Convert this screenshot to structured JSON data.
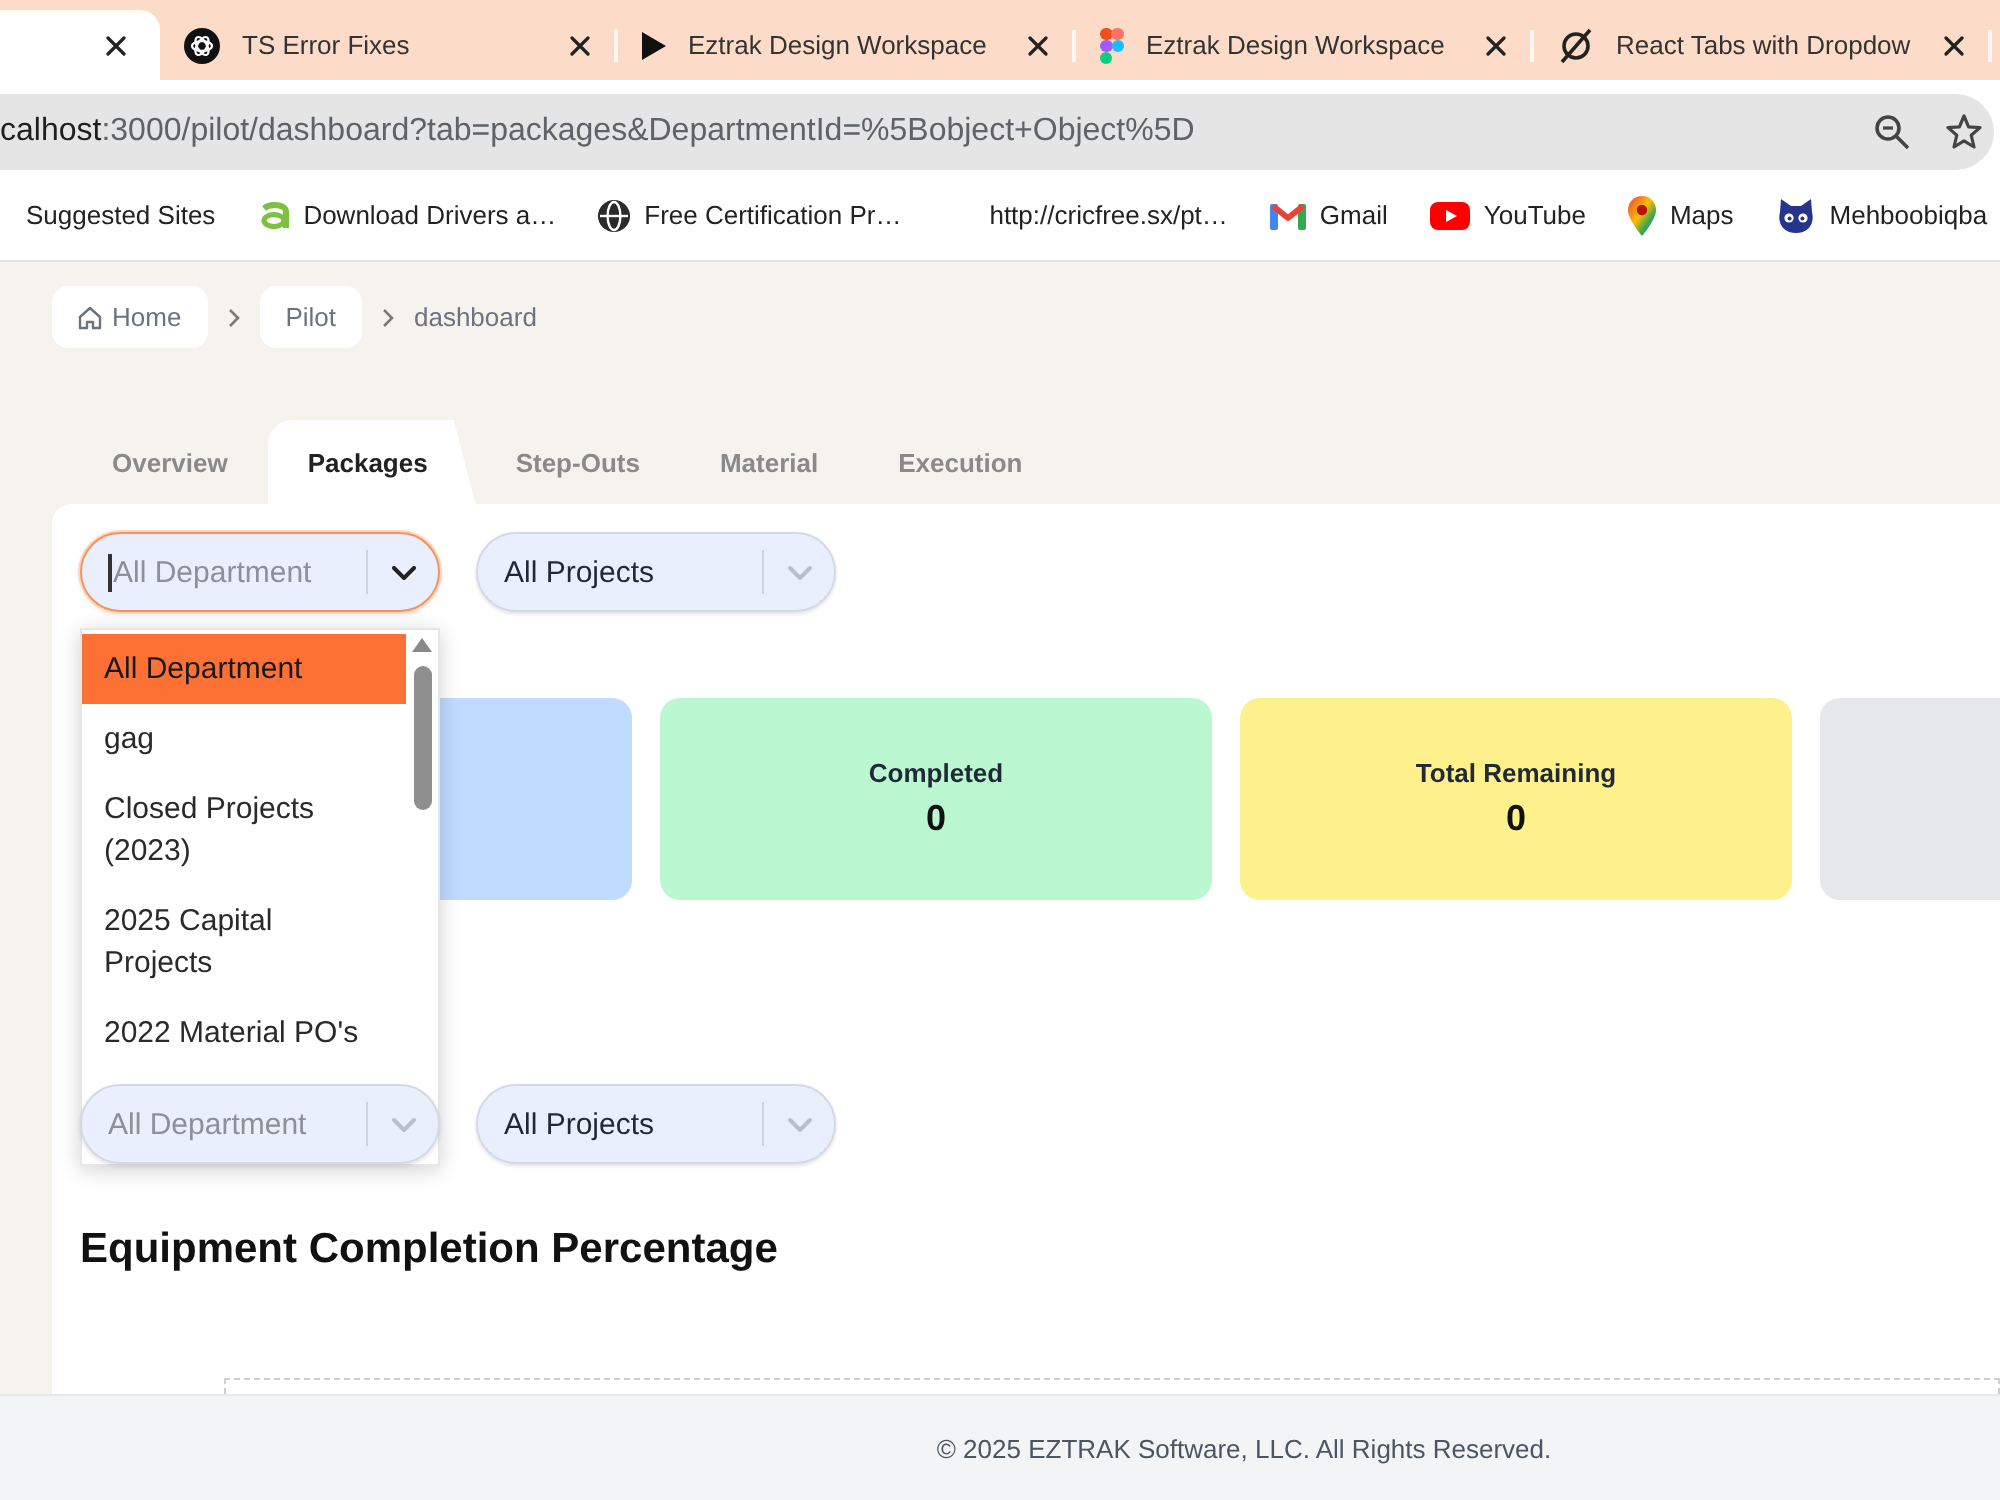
{
  "browser": {
    "tabs": [
      {
        "selected": true
      },
      {
        "title": "TS Error Fixes",
        "selected": false
      },
      {
        "title": "Eztrak Design Workspace",
        "selected": false
      },
      {
        "title": "Eztrak Design Workspace",
        "selected": false
      },
      {
        "title": "React Tabs with Dropdow",
        "selected": false
      }
    ],
    "address": {
      "host": "calhost",
      "path": ":3000/pilot/dashboard?tab=packages&DepartmentId=%5Bobject+Object%5D"
    },
    "bookmarks": [
      "Suggested Sites",
      "Download Drivers a…",
      "Free Certification Pr…",
      "http://cricfree.sx/pt…",
      "Gmail",
      "YouTube",
      "Maps",
      "Mehboobiqba"
    ]
  },
  "breadcrumb": [
    {
      "label": "Home",
      "kind": "link"
    },
    {
      "label": "Pilot",
      "kind": "link"
    },
    {
      "label": "dashboard",
      "kind": "current"
    }
  ],
  "tabs": [
    {
      "label": "Overview",
      "selected": false
    },
    {
      "label": "Packages",
      "selected": true
    },
    {
      "label": "Step-Outs",
      "selected": false
    },
    {
      "label": "Material",
      "selected": false
    },
    {
      "label": "Execution",
      "selected": false
    }
  ],
  "filters": [
    {
      "placeholder": "All Department",
      "focused": true,
      "open": true,
      "options": [
        {
          "label": "All Department",
          "selected": true
        },
        {
          "label": "gag",
          "selected": false
        },
        {
          "label": "Closed Projects (2023)",
          "selected": false
        },
        {
          "label": "2025 Capital Projects",
          "selected": false
        },
        {
          "label": "2022 Material PO's",
          "selected": false
        }
      ]
    },
    {
      "value": "All Projects",
      "focused": false
    }
  ],
  "cards": [
    {
      "color": "#bfdbfe"
    },
    {
      "label": "Completed",
      "value": "0",
      "color": "#bbf7d0"
    },
    {
      "label": "Total Remaining",
      "value": "0",
      "color": "#fef08a"
    },
    {
      "color": "#e5e7eb"
    }
  ],
  "chart_filters": [
    {
      "placeholder": "All Department",
      "focused": false
    },
    {
      "value": "All Projects",
      "focused": false
    }
  ],
  "chart_title": "Equipment Completion Percentage",
  "footer": "© 2025 EZTRAK Software, LLC. All Rights Reserved."
}
